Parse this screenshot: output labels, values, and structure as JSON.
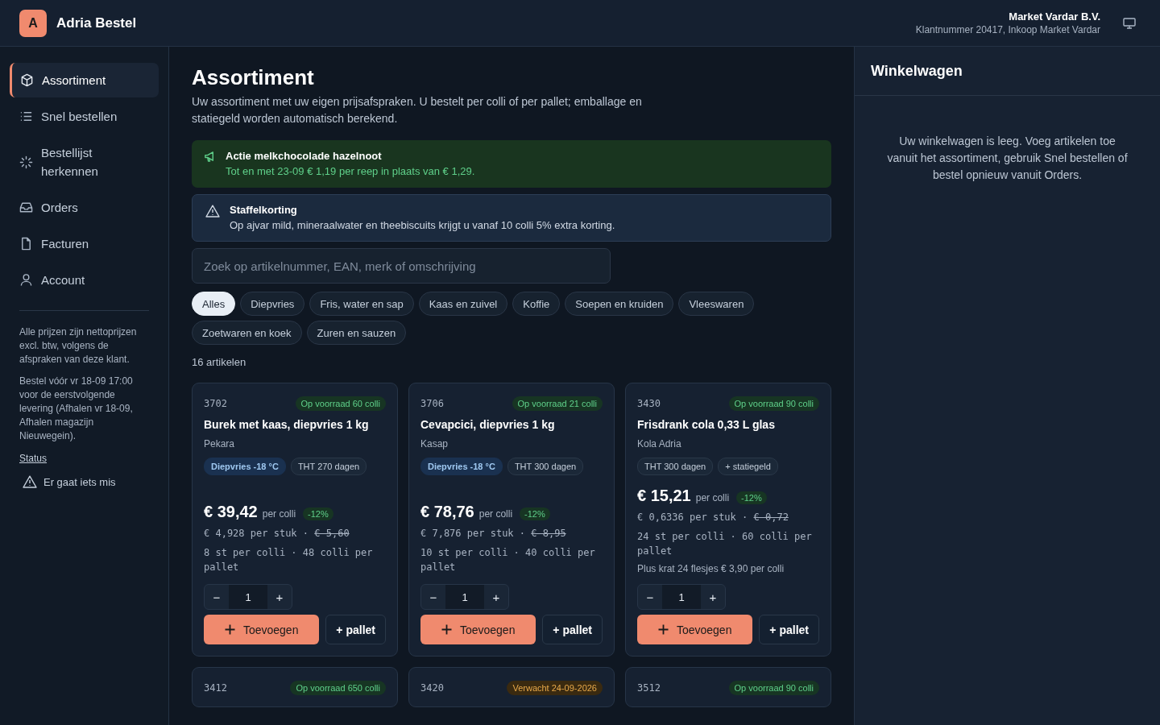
{
  "app": {
    "logo_letter": "A",
    "name": "Adria Bestel"
  },
  "customer": {
    "name": "Market Vardar B.V.",
    "detail": "Klantnummer 20417, Inkoop Market Vardar"
  },
  "sidebar": {
    "items": [
      {
        "label": "Assortiment",
        "selected": true
      },
      {
        "label": "Snel bestellen",
        "selected": false
      },
      {
        "label": "Bestellijst herkennen",
        "selected": false
      },
      {
        "label": "Orders",
        "selected": false
      },
      {
        "label": "Facturen",
        "selected": false
      },
      {
        "label": "Account",
        "selected": false
      }
    ],
    "notes": [
      "Alle prijzen zijn nettoprijzen excl. btw, volgens de afspraken van deze klant.",
      "Bestel vóór vr 18-09 17:00 voor de eerstvolgende levering (Afhalen vr 18-09, Afhalen magazijn Nieuwegein)."
    ],
    "status_link": "Status",
    "problem_link": "Er gaat iets mis"
  },
  "page": {
    "title": "Assortiment",
    "intro": "Uw assortiment met uw eigen prijsafspraken. U bestelt per colli of per pallet; emballage en statiegeld worden automatisch berekend."
  },
  "banners": [
    {
      "kind": "promo",
      "title": "Actie melkchocolade hazelnoot",
      "text": "Tot en met 23-09 € 1,19 per reep in plaats van € 1,29."
    },
    {
      "kind": "warning",
      "title": "Staffelkorting",
      "text": "Op ajvar mild, mineraalwater en theebiscuits krijgt u vanaf 10 colli 5% extra korting."
    }
  ],
  "search": {
    "placeholder": "Zoek op artikelnummer, EAN, merk of omschrijving"
  },
  "filters": [
    {
      "label": "Alles",
      "selected": true
    },
    {
      "label": "Diepvries",
      "selected": false
    },
    {
      "label": "Fris, water en sap",
      "selected": false
    },
    {
      "label": "Kaas en zuivel",
      "selected": false
    },
    {
      "label": "Koffie",
      "selected": false
    },
    {
      "label": "Soepen en kruiden",
      "selected": false
    },
    {
      "label": "Vleeswaren",
      "selected": false
    },
    {
      "label": "Zoetwaren en koek",
      "selected": false
    },
    {
      "label": "Zuren en sauzen",
      "selected": false
    }
  ],
  "count": "16 artikelen",
  "products": [
    {
      "number": "3702",
      "stock": {
        "kind": "in_stock",
        "text": "Op voorraad 60 colli"
      },
      "name": "Burek met kaas, diepvries 1 kg",
      "brand": "Pekara",
      "tags": [
        {
          "kind": "frozen",
          "text": "Diepvries -18 °C"
        },
        {
          "kind": "plain",
          "text": "THT 270 dagen"
        }
      ],
      "price": "€ 39,42",
      "price_unit": "per colli",
      "discount": "-12%",
      "unit_price": "€ 4,928 per stuk ·",
      "old_unit_price": "€ 5,60",
      "packing": "8 st per colli · 48 colli per pallet",
      "qty_minus": "−",
      "qty": "1",
      "qty_plus": "+",
      "add": "Toevoegen",
      "pallet": "+ pallet"
    },
    {
      "number": "3706",
      "stock": {
        "kind": "in_stock",
        "text": "Op voorraad 21 colli"
      },
      "name": "Cevapcici, diepvries 1 kg",
      "brand": "Kasap",
      "tags": [
        {
          "kind": "frozen",
          "text": "Diepvries -18 °C"
        },
        {
          "kind": "plain",
          "text": "THT 300 dagen"
        }
      ],
      "price": "€ 78,76",
      "price_unit": "per colli",
      "discount": "-12%",
      "unit_price": "€ 7,876 per stuk ·",
      "old_unit_price": "€ 8,95",
      "packing": "10 st per colli · 40 colli per pallet",
      "qty_minus": "−",
      "qty": "1",
      "qty_plus": "+",
      "add": "Toevoegen",
      "pallet": "+ pallet"
    },
    {
      "number": "3430",
      "stock": {
        "kind": "in_stock",
        "text": "Op voorraad 90 colli"
      },
      "name": "Frisdrank cola 0,33 L glas",
      "brand": "Kola Adria",
      "tags": [
        {
          "kind": "plain",
          "text": "THT 300 dagen"
        },
        {
          "kind": "plain",
          "text": "+ statiegeld"
        }
      ],
      "price": "€ 15,21",
      "price_unit": "per colli",
      "discount": "-12%",
      "unit_price": "€ 0,6336 per stuk ·",
      "old_unit_price": "€ 0,72",
      "packing": "24 st per colli · 60 colli per pallet",
      "note": "Plus krat 24 flesjes € 3,90 per colli",
      "qty_minus": "−",
      "qty": "1",
      "qty_plus": "+",
      "add": "Toevoegen",
      "pallet": "+ pallet"
    },
    {
      "number": "3412",
      "stock": {
        "kind": "in_stock",
        "text": "Op voorraad 650 colli"
      }
    },
    {
      "number": "3420",
      "stock": {
        "kind": "expected",
        "text": "Verwacht 24-09-2026"
      }
    },
    {
      "number": "3512",
      "stock": {
        "kind": "in_stock",
        "text": "Op voorraad 90 colli"
      }
    }
  ],
  "cart": {
    "title": "Winkelwagen",
    "empty_text": "Uw winkelwagen is leeg. Voeg artikelen toe vanuit het assortiment, gebruik Snel bestellen of bestel opnieuw vanuit Orders."
  }
}
